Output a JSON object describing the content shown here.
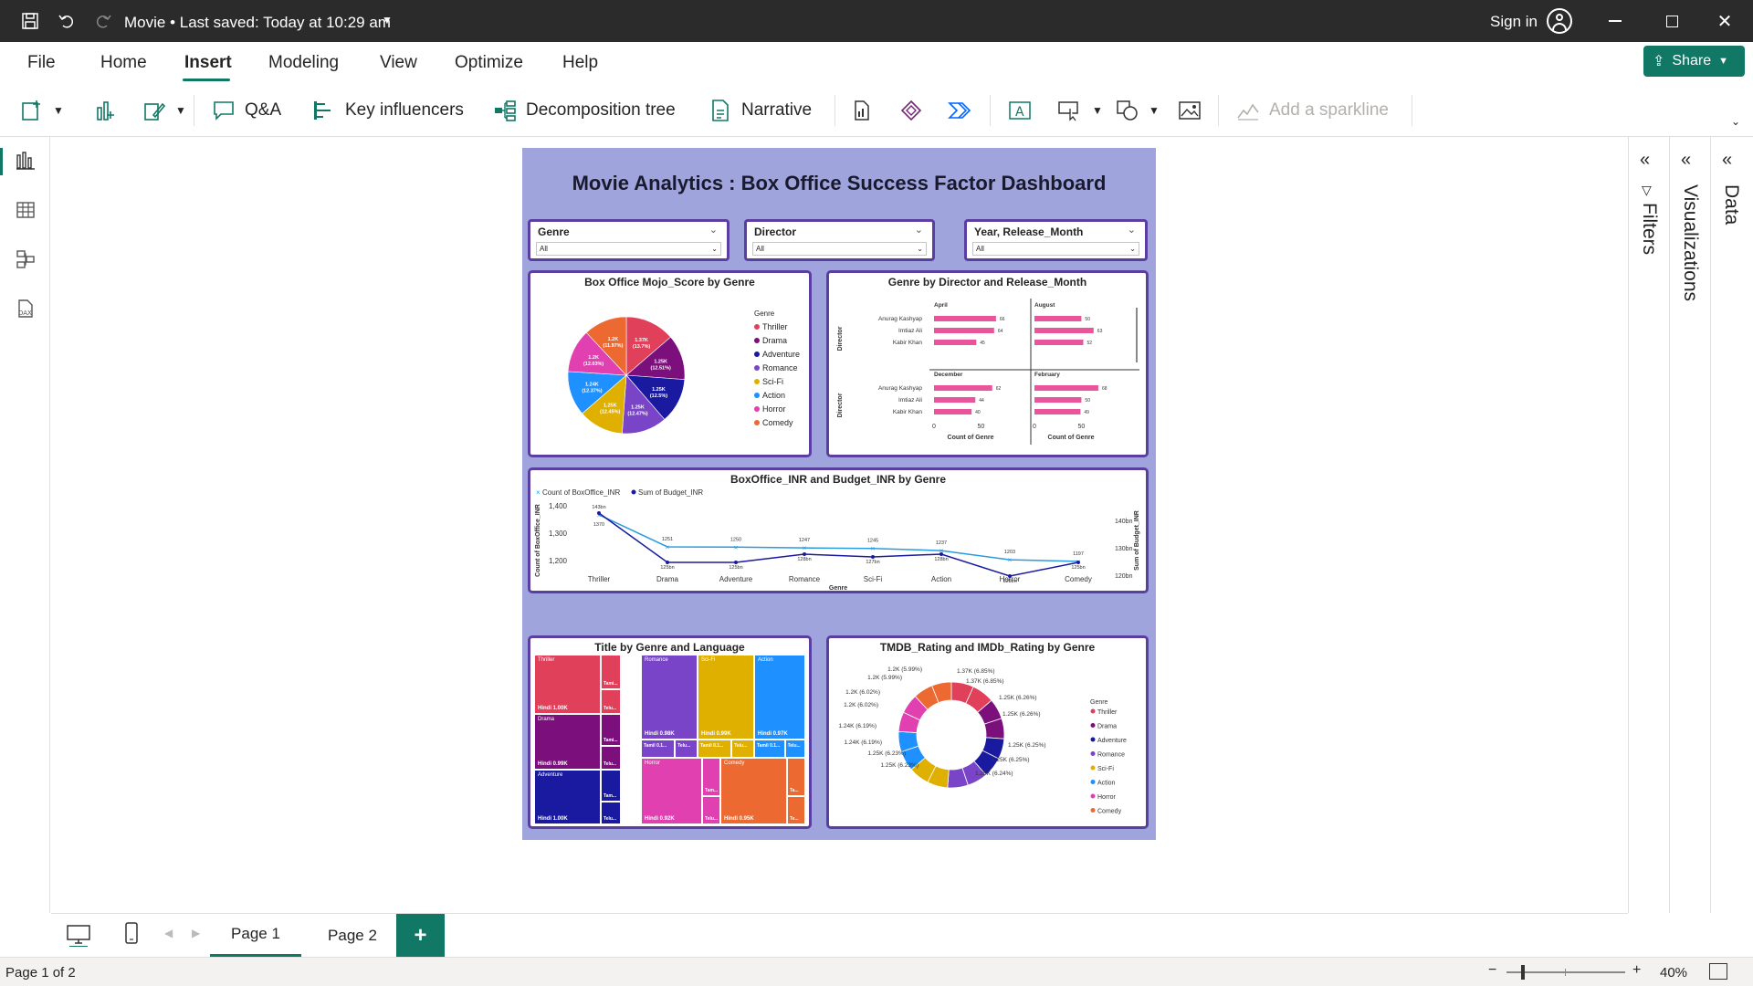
{
  "titlebar": {
    "doc_title": "Movie  •  Last saved: Today at 10:29 am",
    "signin": "Sign in"
  },
  "menu": {
    "items": [
      "File",
      "Home",
      "Insert",
      "Modeling",
      "View",
      "Optimize",
      "Help"
    ],
    "active": "Insert",
    "share": "Share"
  },
  "ribbon": {
    "qa": "Q&A",
    "key_influencers": "Key influencers",
    "decomposition_tree": "Decomposition tree",
    "narrative": "Narrative",
    "add_sparkline": "Add a sparkline"
  },
  "panes": {
    "filters": "Filters",
    "visualizations": "Visualizations",
    "data": "Data"
  },
  "report": {
    "title": "Movie Analytics : Box Office Success Factor Dashboard",
    "slicers": [
      {
        "label": "Genre",
        "value": "All"
      },
      {
        "label": "Director",
        "value": "All"
      },
      {
        "label": "Year, Release_Month",
        "value": "All"
      }
    ],
    "colors": {
      "Thriller": "#e0405a",
      "Drama": "#7b0f7b",
      "Adventure": "#1a1aa0",
      "Romance": "#7a44c8",
      "Sci-Fi": "#e0b000",
      "Action": "#1e90ff",
      "Horror": "#e040b0",
      "Comedy": "#ec6a32"
    },
    "pie": {
      "title": "Box Office Mojo_Score by Genre",
      "legend_title": "Genre",
      "labels": [
        {
          "genre": "Thriller",
          "text": "1.37K",
          "pct": "(13.7%)"
        },
        {
          "genre": "Drama",
          "text": "1.25K",
          "pct": "(12.51%)"
        },
        {
          "genre": "Adventure",
          "text": "1.25K",
          "pct": "(12.5%)"
        },
        {
          "genre": "Romance",
          "text": "1.25K",
          "pct": "(12.47%)"
        },
        {
          "genre": "Sci-Fi",
          "text": "1.25K",
          "pct": "(12.45%)"
        },
        {
          "genre": "Action",
          "text": "1.24K",
          "pct": "(12.37%)"
        },
        {
          "genre": "Horror",
          "text": "1.2K",
          "pct": "(12.03%)"
        },
        {
          "genre": "Comedy",
          "text": "1.2K",
          "pct": "(11.97%)"
        }
      ]
    },
    "small_multiples": {
      "title": "Genre by Director and Release_Month",
      "y_axis": "Director",
      "x_axis": "Count of Genre",
      "directors": [
        "Anurag Kashyap",
        "Imtiaz Ali",
        "Kabir Khan"
      ],
      "panels": [
        {
          "month": "April",
          "values": [
            66,
            64,
            45
          ]
        },
        {
          "month": "August",
          "values": [
            50,
            63,
            52
          ]
        },
        {
          "month": "December",
          "values": [
            62,
            44,
            40
          ]
        },
        {
          "month": "February",
          "values": [
            68,
            50,
            49
          ]
        }
      ],
      "ticks": [
        "0",
        "50"
      ]
    },
    "line": {
      "title": "BoxOffice_INR and Budget_INR by Genre",
      "legend": [
        "Count of BoxOffice_INR",
        "Sum of Budget_INR"
      ],
      "y_left_label": "Count of BoxOffice_INR",
      "y_right_label": "Sum of Budget_INR",
      "x_label": "Genre",
      "y_left_ticks": [
        "1,400",
        "1,300",
        "1,200"
      ],
      "y_right_ticks": [
        "140bn",
        "130bn",
        "120bn"
      ],
      "categories": [
        "Thriller",
        "Drama",
        "Adventure",
        "Romance",
        "Sci-Fi",
        "Action",
        "Horror",
        "Comedy"
      ],
      "count_values": [
        1370,
        1251,
        1250,
        1247,
        1245,
        1237,
        1203,
        1197
      ],
      "count_labels": [
        "1370",
        "1251",
        "1250",
        "1247",
        "1245",
        "1237",
        "1203",
        "1197"
      ],
      "budget_values": [
        143,
        125,
        125,
        128,
        127,
        128,
        120,
        125
      ],
      "budget_labels": [
        "143bn",
        "125bn",
        "125bn",
        "128bn",
        "127bn",
        "128bn",
        "120bn",
        "125bn"
      ]
    },
    "treemap": {
      "title": "Title by Genre and Language",
      "tiles": [
        {
          "genre": "Thriller",
          "label": "Thriller",
          "value": "Hindi 1.00K",
          "side": [
            "Tami...",
            "Telu..."
          ]
        },
        {
          "genre": "Drama",
          "label": "Drama",
          "value": "Hindi 0.99K",
          "side": [
            "Tami...",
            "Telu..."
          ]
        },
        {
          "genre": "Adventure",
          "label": "Adventure",
          "value": "Hindi 1.00K",
          "side": [
            "Tam...",
            "Telu..."
          ]
        },
        {
          "genre": "Romance",
          "label": "Romance",
          "value": "Hindi 0.98K",
          "side": [
            "Tamil 0.1...",
            "Telu..."
          ]
        },
        {
          "genre": "Sci-Fi",
          "label": "Sci-Fi",
          "value": "Hindi 0.99K",
          "side": [
            "Tamil 0.1...",
            "Telu..."
          ]
        },
        {
          "genre": "Action",
          "label": "Action",
          "value": "Hindi 0.97K",
          "side": [
            "Tamil 0.1...",
            "Telu..."
          ]
        },
        {
          "genre": "Horror",
          "label": "Horror",
          "value": "Hindi 0.92K",
          "side": [
            "Tam...",
            "Telu..."
          ]
        },
        {
          "genre": "Comedy",
          "label": "Comedy",
          "value": "Hindi 0.95K",
          "side": [
            "Ta...",
            "Te..."
          ]
        }
      ]
    },
    "donut": {
      "title": "TMDB_Rating and IMDb_Rating by Genre",
      "legend_title": "Genre",
      "labels": [
        "1.37K (6.85%)",
        "1.37K (6.85%)",
        "1.25K (6.26%)",
        "1.25K (6.26%)",
        "1.25K (6.25%)",
        "1.25K (6.25%)",
        "1.25K (6.24%)",
        "1.25K (6.23%)",
        "1.25K (6.23%)",
        "1.24K (6.19%)",
        "1.24K (6.19%)",
        "1.2K (6.02%)",
        "1.2K (6.02%)",
        "1.2K (5.99%)",
        "1.2K (5.99%)"
      ]
    }
  },
  "pages": {
    "tabs": [
      "Page 1",
      "Page 2"
    ],
    "add": "+"
  },
  "status": {
    "page_info": "Page 1 of 2",
    "zoom": "40%"
  }
}
